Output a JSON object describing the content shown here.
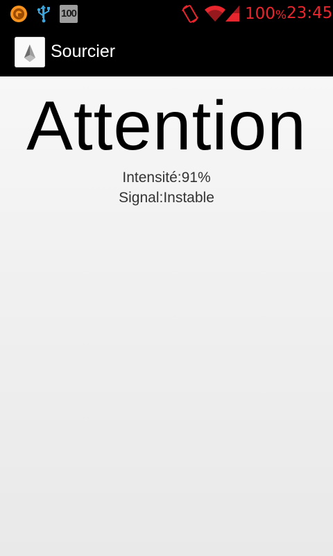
{
  "status_bar": {
    "icons_left": [
      "vlc-player-icon",
      "usb-icon",
      "storage-full-icon"
    ],
    "storage_badge": "100",
    "icons_right": [
      "screen-rotation-icon",
      "wifi-icon",
      "signal-icon"
    ],
    "battery_value": "100",
    "battery_unit": "%",
    "time": "23:45",
    "accent_color": "#e8262d"
  },
  "action_bar": {
    "app_icon": "diamond-pendulum-icon",
    "title": "Sourcier"
  },
  "main": {
    "headline": "Attention",
    "intensity": "Intensité:91%",
    "signal": "Signal:Instable"
  }
}
